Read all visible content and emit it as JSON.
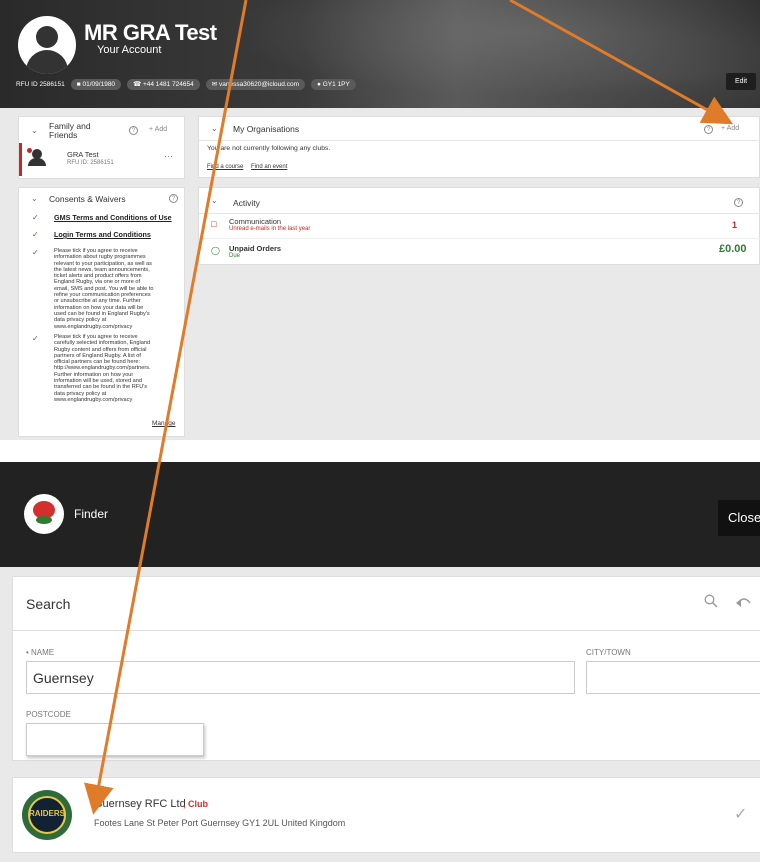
{
  "profile": {
    "name": "MR GRA Test",
    "subtitle": "Your Account",
    "rfu_id": "RFU ID   2586151",
    "dob": "01/09/1980",
    "phone": "+44 1481 724654",
    "email": "vanessa30620@icloud.com",
    "postcode": "GY1 1PY",
    "edit_label": "Edit"
  },
  "family": {
    "title": "Family and Friends",
    "add_label": "+ Add",
    "member_name": "GRA Test",
    "member_id": "RFU ID: 2586151",
    "more": "···"
  },
  "consents": {
    "title": "Consents & Waivers",
    "items": [
      {
        "label": "GMS Terms and Conditions of Use"
      },
      {
        "label": "Login Terms and Conditions"
      }
    ],
    "para1": "Please tick if you agree to receive information about rugby programmes relevant to your participation, as well as the latest news, team announcements, ticket alerts and product offers from England Rugby, via one or more of email, SMS and post. You will be able to refine your communication preferences or unsubscribe at any time. Further information on how your data will be used can be found in England Rugby's data privacy policy at www.englandrugby.com/privacy",
    "para2": "Please tick if you agree to receive carefully selected information, England Rugby content and offers from official partners of England Rugby. A list of official partners can be found here: http://www.englandrugby.com/partners. Further information on how your information will be used, stored and transferred can be found in the RFU's data privacy policy at www.englandrugby.com/privacy",
    "manage": "Manage"
  },
  "organisations": {
    "title": "My Organisations",
    "add_label": "+ Add",
    "empty": "You are not currently following any clubs.",
    "link1": "Find a course",
    "link2": "Find an event"
  },
  "activity": {
    "title": "Activity",
    "comm_title": "Communication",
    "comm_sub": "Unread e-mails in the last year",
    "comm_value": "1",
    "orders_title": "Unpaid Orders",
    "orders_sub": "Due",
    "orders_value": "£0.00"
  },
  "finder": {
    "title": "Finder",
    "close": "Close",
    "search_title": "Search",
    "name_label": "NAME",
    "name_value": "Guernsey",
    "city_label": "CITY/TOWN",
    "city_value": "",
    "postcode_label": "POSTCODE",
    "postcode_value": ""
  },
  "result": {
    "name": "Guernsey RFC Ltd",
    "type": ", Club",
    "address": "Footes Lane St Peter Port Guernsey GY1 2UL United Kingdom",
    "badge_text": "RAIDERS"
  },
  "colors": {
    "arrow": "#e07b2a",
    "club_red": "#d32f2f",
    "money_green": "#2e7d32"
  }
}
